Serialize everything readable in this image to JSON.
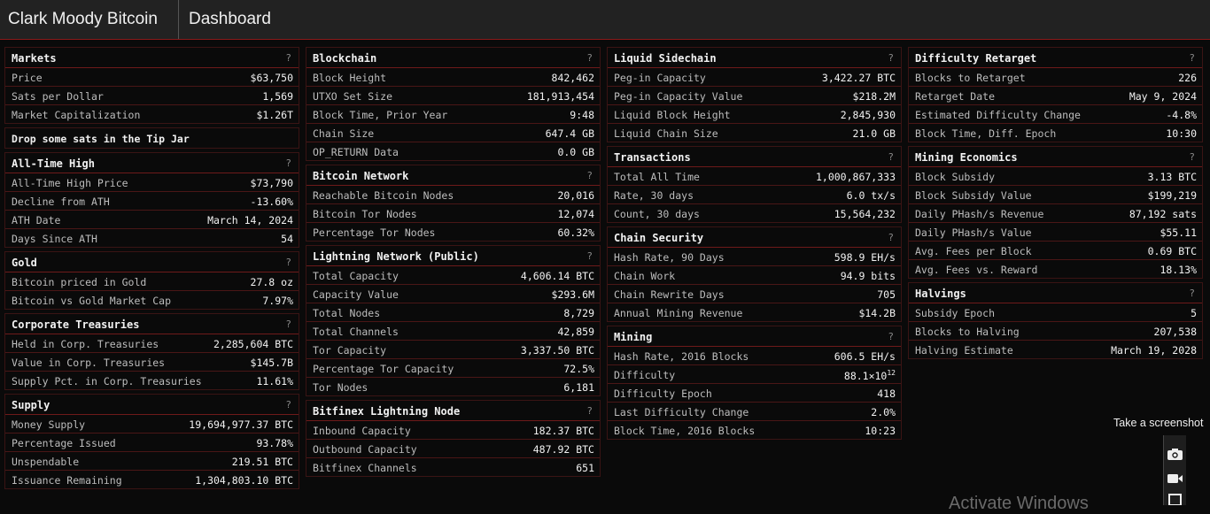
{
  "header": {
    "brand": "Clark Moody Bitcoin",
    "page": "Dashboard"
  },
  "help_glyph": "?",
  "columns": [
    {
      "panels": [
        {
          "title": "Markets",
          "rows": [
            [
              "Price",
              "$63,750"
            ],
            [
              "Sats per Dollar",
              "1,569"
            ],
            [
              "Market Capitalization",
              "$1.26T"
            ]
          ]
        },
        {
          "tip": "Drop some sats in the Tip Jar"
        },
        {
          "title": "All-Time High",
          "rows": [
            [
              "All-Time High Price",
              "$73,790"
            ],
            [
              "Decline from ATH",
              "-13.60%"
            ],
            [
              "ATH Date",
              "March 14, 2024"
            ],
            [
              "Days Since ATH",
              "54"
            ]
          ]
        },
        {
          "title": "Gold",
          "rows": [
            [
              "Bitcoin priced in Gold",
              "27.8 oz"
            ],
            [
              "Bitcoin vs Gold Market Cap",
              "7.97%"
            ]
          ]
        },
        {
          "title": "Corporate Treasuries",
          "rows": [
            [
              "Held in Corp. Treasuries",
              "2,285,604 BTC"
            ],
            [
              "Value in Corp. Treasuries",
              "$145.7B"
            ],
            [
              "Supply Pct. in Corp. Treasuries",
              "11.61%"
            ]
          ]
        },
        {
          "title": "Supply",
          "rows": [
            [
              "Money Supply",
              "19,694,977.37 BTC"
            ],
            [
              "Percentage Issued",
              "93.78%"
            ],
            [
              "Unspendable",
              "219.51 BTC"
            ],
            [
              "Issuance Remaining",
              "1,304,803.10 BTC"
            ]
          ]
        }
      ]
    },
    {
      "panels": [
        {
          "title": "Blockchain",
          "rows": [
            [
              "Block Height",
              "842,462"
            ],
            [
              "UTXO Set Size",
              "181,913,454"
            ],
            [
              "Block Time, Prior Year",
              "9:48"
            ],
            [
              "Chain Size",
              "647.4 GB"
            ],
            [
              "OP_RETURN Data",
              "0.0 GB"
            ]
          ]
        },
        {
          "title": "Bitcoin Network",
          "rows": [
            [
              "Reachable Bitcoin Nodes",
              "20,016"
            ],
            [
              "Bitcoin Tor Nodes",
              "12,074"
            ],
            [
              "Percentage Tor Nodes",
              "60.32%"
            ]
          ]
        },
        {
          "title": "Lightning Network (Public)",
          "rows": [
            [
              "Total Capacity",
              "4,606.14 BTC"
            ],
            [
              "Capacity Value",
              "$293.6M"
            ],
            [
              "Total Nodes",
              "8,729"
            ],
            [
              "Total Channels",
              "42,859"
            ],
            [
              "Tor Capacity",
              "3,337.50 BTC"
            ],
            [
              "Percentage Tor Capacity",
              "72.5%"
            ],
            [
              "Tor Nodes",
              "6,181"
            ]
          ]
        },
        {
          "title": "Bitfinex Lightning Node",
          "rows": [
            [
              "Inbound Capacity",
              "182.37 BTC"
            ],
            [
              "Outbound Capacity",
              "487.92 BTC"
            ],
            [
              "Bitfinex Channels",
              "651"
            ]
          ]
        }
      ]
    },
    {
      "panels": [
        {
          "title": "Liquid Sidechain",
          "rows": [
            [
              "Peg-in Capacity",
              "3,422.27 BTC"
            ],
            [
              "Peg-in Capacity Value",
              "$218.2M"
            ],
            [
              "Liquid Block Height",
              "2,845,930"
            ],
            [
              "Liquid Chain Size",
              "21.0 GB"
            ]
          ]
        },
        {
          "title": "Transactions",
          "rows": [
            [
              "Total All Time",
              "1,000,867,333"
            ],
            [
              "Rate, 30 days",
              "6.0 tx/s"
            ],
            [
              "Count, 30 days",
              "15,564,232"
            ]
          ]
        },
        {
          "title": "Chain Security",
          "rows": [
            [
              "Hash Rate, 90 Days",
              "598.9 EH/s"
            ],
            [
              "Chain Work",
              "94.9 bits"
            ],
            [
              "Chain Rewrite Days",
              "705"
            ],
            [
              "Annual Mining Revenue",
              "$14.2B"
            ]
          ]
        },
        {
          "title": "Mining",
          "rows": [
            [
              "Hash Rate, 2016 Blocks",
              "606.5 EH/s"
            ],
            [
              "Difficulty",
              "88.1×10",
              "12"
            ],
            [
              "Difficulty Epoch",
              "418"
            ],
            [
              "Last Difficulty Change",
              "2.0%"
            ],
            [
              "Block Time, 2016 Blocks",
              "10:23"
            ]
          ]
        }
      ]
    },
    {
      "panels": [
        {
          "title": "Difficulty Retarget",
          "rows": [
            [
              "Blocks to Retarget",
              "226"
            ],
            [
              "Retarget Date",
              "May 9, 2024"
            ],
            [
              "Estimated Difficulty Change",
              "-4.8%"
            ],
            [
              "Block Time, Diff. Epoch",
              "10:30"
            ]
          ]
        },
        {
          "title": "Mining Economics",
          "rows": [
            [
              "Block Subsidy",
              "3.13 BTC"
            ],
            [
              "Block Subsidy Value",
              "$199,219"
            ],
            [
              "Daily PHash/s Revenue",
              "87,192 sats"
            ],
            [
              "Daily PHash/s Value",
              "$55.11"
            ],
            [
              "Avg. Fees per Block",
              "0.69 BTC"
            ],
            [
              "Avg. Fees vs. Reward",
              "18.13%"
            ]
          ]
        },
        {
          "title": "Halvings",
          "rows": [
            [
              "Subsidy Epoch",
              "5"
            ],
            [
              "Blocks to Halving",
              "207,538"
            ],
            [
              "Halving Estimate",
              "March 19, 2028"
            ]
          ]
        }
      ]
    }
  ],
  "overlay": {
    "screenshot_label": "Take a screenshot",
    "camera_icon": "camera-icon",
    "video_icon": "video-icon",
    "watermark": "Activate Windows"
  }
}
